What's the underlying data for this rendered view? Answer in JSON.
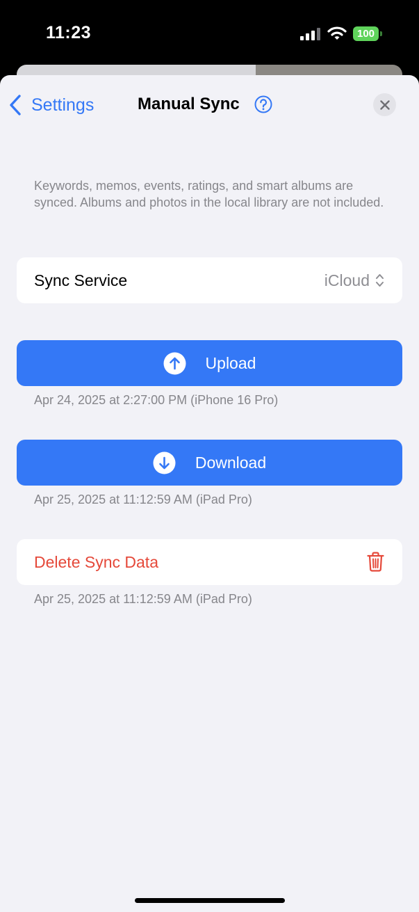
{
  "status_bar": {
    "time": "11:23",
    "battery": "100",
    "icons": [
      "signal-icon",
      "wifi-icon",
      "battery-icon"
    ]
  },
  "nav": {
    "back_label": "Settings",
    "title": "Manual Sync",
    "icons": [
      "chevron-left-icon",
      "help-icon",
      "close-icon"
    ]
  },
  "description": "Keywords, memos, events, ratings, and smart albums are synced. Albums and photos in the local library are not included.",
  "sync_service": {
    "label": "Sync Service",
    "value": "iCloud"
  },
  "upload": {
    "label": "Upload",
    "timestamp": "Apr 24, 2025 at 2:27:00 PM (iPhone 16 Pro)"
  },
  "download": {
    "label": "Download",
    "timestamp": "Apr 25, 2025 at 11:12:59 AM (iPad Pro)"
  },
  "delete": {
    "label": "Delete Sync Data",
    "timestamp": "Apr 25, 2025 at 11:12:59 AM (iPad Pro)"
  },
  "colors": {
    "accent": "#3478f6",
    "destructive": "#e5493a",
    "background": "#f2f2f7",
    "secondary_text": "#86868b",
    "battery": "#5fd35b"
  }
}
